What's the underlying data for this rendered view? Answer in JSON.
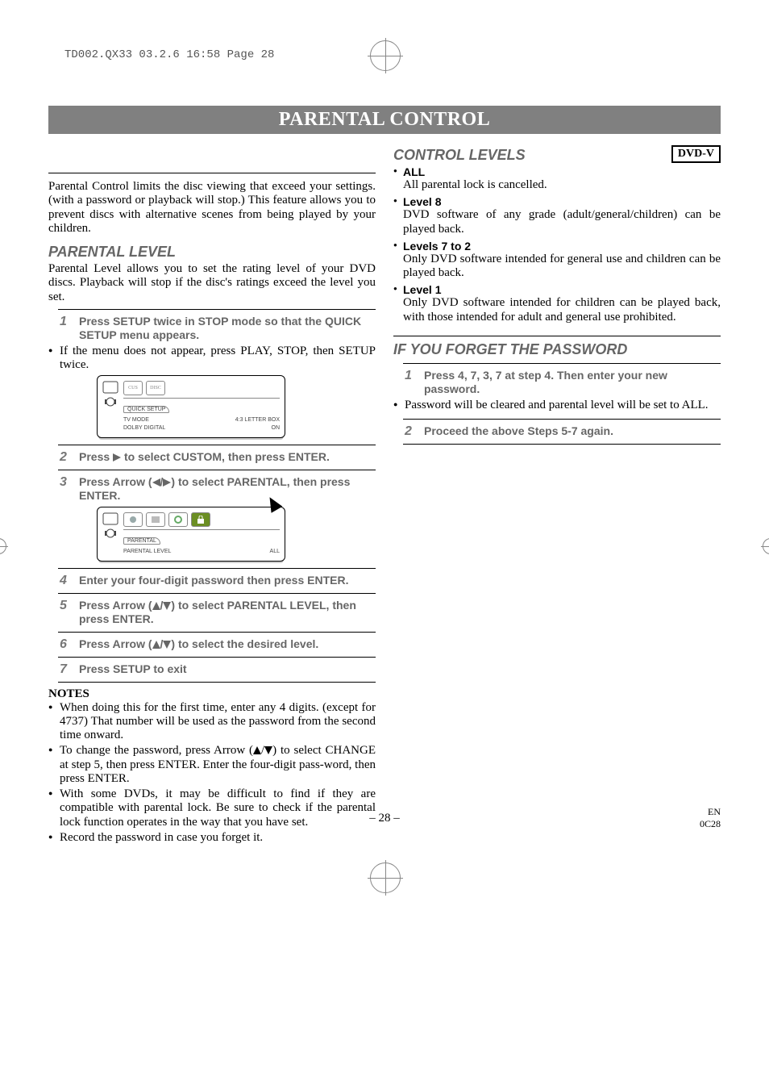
{
  "slug": "TD002.QX33  03.2.6  16:58  Page 28",
  "banner_title": "PARENTAL CONTROL",
  "dvd_badge": "DVD-V",
  "intro_paragraph": "Parental Control limits the disc viewing that exceed your settings. (with a password or playback will stop.) This feature allows you to prevent discs with alternative scenes from being played by your children.",
  "parental_level": {
    "heading": "PARENTAL LEVEL",
    "desc": "Parental Level allows you to set the rating level of your DVD discs. Playback will stop if the disc's ratings exceed the level you set."
  },
  "steps": {
    "s1": "Press SETUP twice in STOP mode so that the QUICK SETUP menu appears.",
    "s1_bullet": "If the menu does not appear, press PLAY, STOP, then SETUP twice.",
    "s2_a": "Press ",
    "s2_b": " to select CUSTOM, then press ENTER.",
    "s3_a": "Press Arrow (",
    "s3_b": "/",
    "s3_c": ") to select PARENTAL, then press ENTER.",
    "s4": "Enter your four-digit password then press ENTER.",
    "s5_a": "Press Arrow (",
    "s5_b": "/",
    "s5_c": ") to select PARENTAL LEVEL, then press ENTER.",
    "s6_a": "Press Arrow (",
    "s6_b": "/",
    "s6_c": ") to select the desired level.",
    "s7": "Press SETUP to exit"
  },
  "osd1": {
    "tab_label": "QUICK SETUP",
    "line1a": "TV MODE",
    "line1b": "4:3 LETTER BOX",
    "line2a": "DOLBY DIGITAL",
    "line2b": "ON"
  },
  "osd2": {
    "tab_label": "PARENTAL",
    "line1a": "PARENTAL LEVEL",
    "line1b": "ALL"
  },
  "notes": {
    "heading": "NOTES",
    "n1": "When doing this for the first time, enter any 4 digits. (except for 4737) That number will be used as the password from the second time onward.",
    "n2_a": "To change the password, press Arrow (",
    "n2_b": "/",
    "n2_c": ") to select CHANGE at step 5, then press ENTER. Enter the four-digit pass-word, then press ENTER.",
    "n3": "With some DVDs, it may be difficult to find if they are compatible with parental lock. Be sure to check if the parental lock function operates in the way that you have set.",
    "n4": "Record the password in case you forget it."
  },
  "control_levels": {
    "heading": "CONTROL LEVELS",
    "items": [
      {
        "term": "ALL",
        "desc": "All parental lock is cancelled."
      },
      {
        "term": "Level 8",
        "desc": "DVD software of any grade (adult/general/children) can be played back."
      },
      {
        "term": "Levels 7 to 2",
        "desc": "Only DVD software intended for general use and children can be played back."
      },
      {
        "term": "Level 1",
        "desc": "Only DVD software intended for children can be played back, with those intended for adult and general use prohibited."
      }
    ]
  },
  "forget": {
    "heading": "IF YOU FORGET THE PASSWORD",
    "s1": "Press 4, 7, 3, 7 at step 4. Then enter your new password.",
    "bullet": "Password will be cleared and parental level will be set to ALL.",
    "s2": "Proceed the above Steps 5-7 again."
  },
  "footer": {
    "page": "– 28 –",
    "lang": "EN",
    "code": "0C28"
  }
}
